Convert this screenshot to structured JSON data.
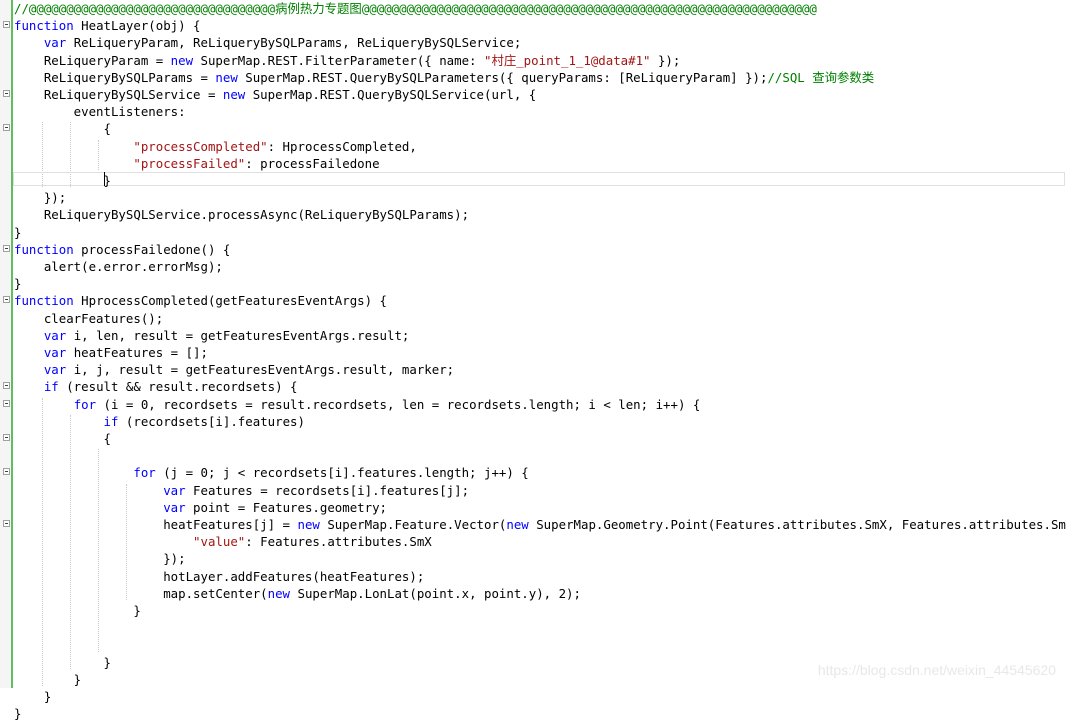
{
  "editor": {
    "colors": {
      "keyword": "#0000ff",
      "string": "#a31515",
      "comment": "#008000",
      "text": "#000000"
    },
    "lines": [
      {
        "fold": false,
        "segs": [
          {
            "t": "//@@@@@@@@@@@@@@@@@@@@@@@@@@@@@@@@@病例热力专题图@@@@@@@@@@@@@@@@@@@@@@@@@@@@@@@@@@@@@@@@@@@@@@@@@@@@@@@@@@@@@",
            "c": "cmt"
          }
        ]
      },
      {
        "fold": true,
        "segs": [
          {
            "t": "function",
            "c": "kw"
          },
          {
            "t": " HeatLayer(obj) {"
          }
        ]
      },
      {
        "fold": false,
        "segs": [
          {
            "t": "    "
          },
          {
            "t": "var",
            "c": "kw"
          },
          {
            "t": " ReLiqueryParam, ReLiqueryBySQLParams, ReLiqueryBySQLService;"
          }
        ]
      },
      {
        "fold": false,
        "segs": [
          {
            "t": "    ReLiqueryParam = "
          },
          {
            "t": "new",
            "c": "kw"
          },
          {
            "t": " SuperMap.REST.FilterParameter({ name: "
          },
          {
            "t": "\"村庄_point_1_1@data#1\"",
            "c": "str"
          },
          {
            "t": " });"
          }
        ]
      },
      {
        "fold": false,
        "segs": [
          {
            "t": "    ReLiqueryBySQLParams = "
          },
          {
            "t": "new",
            "c": "kw"
          },
          {
            "t": " SuperMap.REST.QueryBySQLParameters({ queryParams: [ReLiqueryParam] });"
          },
          {
            "t": "//SQL 查询参数类",
            "c": "cmt"
          }
        ]
      },
      {
        "fold": true,
        "segs": [
          {
            "t": "    ReLiqueryBySQLService = "
          },
          {
            "t": "new",
            "c": "kw"
          },
          {
            "t": " SuperMap.REST.QueryBySQLService(url, {"
          }
        ]
      },
      {
        "fold": false,
        "segs": [
          {
            "t": "        eventListeners:"
          }
        ]
      },
      {
        "fold": true,
        "segs": [
          {
            "t": "            {"
          }
        ]
      },
      {
        "fold": false,
        "segs": [
          {
            "t": "                "
          },
          {
            "t": "\"processCompleted\"",
            "c": "str"
          },
          {
            "t": ": HprocessCompleted,"
          }
        ]
      },
      {
        "fold": false,
        "segs": [
          {
            "t": "                "
          },
          {
            "t": "\"processFailed\"",
            "c": "str"
          },
          {
            "t": ": processFailedone"
          }
        ]
      },
      {
        "fold": false,
        "segs": [
          {
            "t": "            }"
          }
        ]
      },
      {
        "fold": false,
        "segs": [
          {
            "t": "    });"
          }
        ]
      },
      {
        "fold": false,
        "segs": [
          {
            "t": "    ReLiqueryBySQLService.processAsync(ReLiqueryBySQLParams);"
          }
        ]
      },
      {
        "fold": false,
        "segs": [
          {
            "t": "}"
          }
        ]
      },
      {
        "fold": true,
        "segs": [
          {
            "t": "function",
            "c": "kw"
          },
          {
            "t": " processFailedone() {"
          }
        ]
      },
      {
        "fold": false,
        "segs": [
          {
            "t": "    alert(e.error.errorMsg);"
          }
        ]
      },
      {
        "fold": false,
        "segs": [
          {
            "t": "}"
          }
        ]
      },
      {
        "fold": true,
        "segs": [
          {
            "t": "function",
            "c": "kw"
          },
          {
            "t": " HprocessCompleted(getFeaturesEventArgs) {"
          }
        ]
      },
      {
        "fold": false,
        "segs": [
          {
            "t": "    clearFeatures();"
          }
        ]
      },
      {
        "fold": false,
        "segs": [
          {
            "t": "    "
          },
          {
            "t": "var",
            "c": "kw"
          },
          {
            "t": " i, len, result = getFeaturesEventArgs.result;"
          }
        ]
      },
      {
        "fold": false,
        "segs": [
          {
            "t": "    "
          },
          {
            "t": "var",
            "c": "kw"
          },
          {
            "t": " heatFeatures = [];"
          }
        ]
      },
      {
        "fold": false,
        "segs": [
          {
            "t": "    "
          },
          {
            "t": "var",
            "c": "kw"
          },
          {
            "t": " i, j, result = getFeaturesEventArgs.result, marker;"
          }
        ]
      },
      {
        "fold": true,
        "segs": [
          {
            "t": "    "
          },
          {
            "t": "if",
            "c": "kw"
          },
          {
            "t": " (result && result.recordsets) {"
          }
        ]
      },
      {
        "fold": true,
        "segs": [
          {
            "t": "        "
          },
          {
            "t": "for",
            "c": "kw"
          },
          {
            "t": " (i = 0, recordsets = result.recordsets, len = recordsets.length; i < len; i++) {"
          }
        ]
      },
      {
        "fold": false,
        "segs": [
          {
            "t": "            "
          },
          {
            "t": "if",
            "c": "kw"
          },
          {
            "t": " (recordsets[i].features)"
          }
        ]
      },
      {
        "fold": true,
        "segs": [
          {
            "t": "            {"
          }
        ]
      },
      {
        "fold": false,
        "segs": [
          {
            "t": ""
          }
        ]
      },
      {
        "fold": true,
        "segs": [
          {
            "t": "                "
          },
          {
            "t": "for",
            "c": "kw"
          },
          {
            "t": " (j = 0; j < recordsets[i].features.length; j++) {"
          }
        ]
      },
      {
        "fold": false,
        "segs": [
          {
            "t": "                    "
          },
          {
            "t": "var",
            "c": "kw"
          },
          {
            "t": " Features = recordsets[i].features[j];"
          }
        ]
      },
      {
        "fold": false,
        "segs": [
          {
            "t": "                    "
          },
          {
            "t": "var",
            "c": "kw"
          },
          {
            "t": " point = Features.geometry;"
          }
        ]
      },
      {
        "fold": true,
        "segs": [
          {
            "t": "                    heatFeatures[j] = "
          },
          {
            "t": "new",
            "c": "kw"
          },
          {
            "t": " SuperMap.Feature.Vector("
          },
          {
            "t": "new",
            "c": "kw"
          },
          {
            "t": " SuperMap.Geometry.Point(Features.attributes.SmX, Features.attributes.SmY), {"
          }
        ]
      },
      {
        "fold": false,
        "segs": [
          {
            "t": "                        "
          },
          {
            "t": "\"value\"",
            "c": "str"
          },
          {
            "t": ": Features.attributes.SmX"
          }
        ]
      },
      {
        "fold": false,
        "segs": [
          {
            "t": "                    });"
          }
        ]
      },
      {
        "fold": false,
        "segs": [
          {
            "t": "                    hotLayer.addFeatures(heatFeatures);"
          }
        ]
      },
      {
        "fold": false,
        "segs": [
          {
            "t": "                    map.setCenter("
          },
          {
            "t": "new",
            "c": "kw"
          },
          {
            "t": " SuperMap.LonLat(point.x, point.y), 2);"
          }
        ]
      },
      {
        "fold": false,
        "segs": [
          {
            "t": "                }"
          }
        ]
      },
      {
        "fold": false,
        "segs": [
          {
            "t": ""
          }
        ]
      },
      {
        "fold": false,
        "segs": [
          {
            "t": ""
          }
        ]
      },
      {
        "fold": false,
        "segs": [
          {
            "t": "            }"
          }
        ]
      },
      {
        "fold": false,
        "segs": [
          {
            "t": "        }"
          }
        ]
      },
      {
        "fold": false,
        "segs": [
          {
            "t": "    }"
          }
        ]
      },
      {
        "fold": false,
        "segs": [
          {
            "t": "}"
          }
        ]
      }
    ]
  },
  "watermark": "https://blog.csdn.net/weixin_44545620"
}
